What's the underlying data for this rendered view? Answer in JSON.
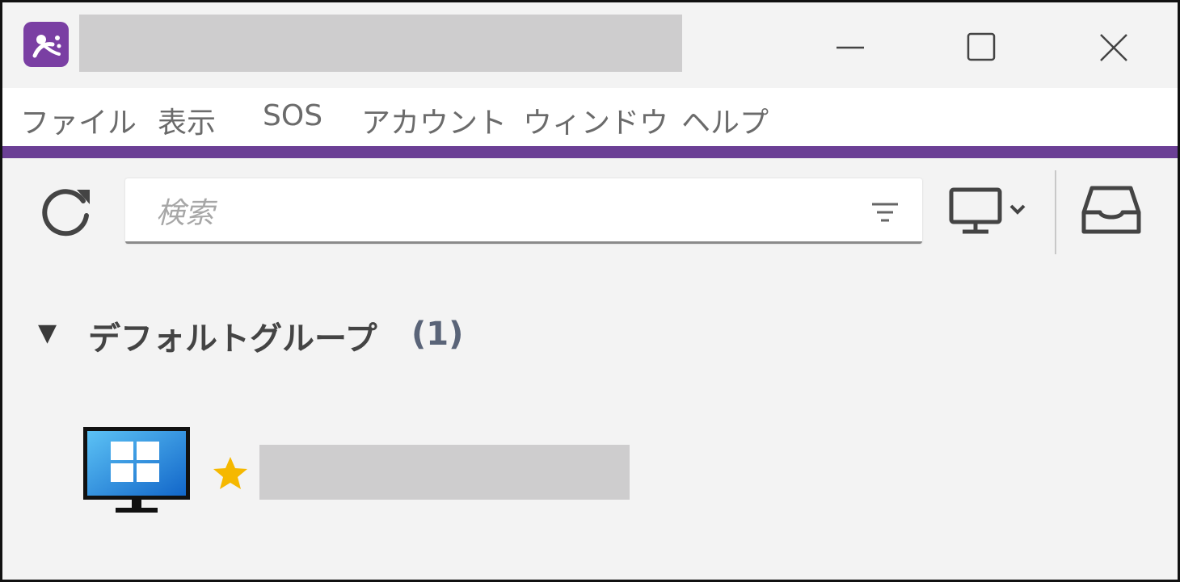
{
  "titlebar": {
    "app_icon": "splashtop-app-icon",
    "title_redacted": true,
    "buttons": [
      "minimize-icon",
      "maximize-icon",
      "close-icon"
    ]
  },
  "menu": {
    "items": [
      "ファイル",
      "表示",
      "SOS",
      "アカウント",
      "ウィンドウ",
      "ヘルプ"
    ]
  },
  "toolbar": {
    "refresh_icon": "refresh-icon",
    "search_placeholder": "検索",
    "filter_icon": "filter-icon",
    "view_icon": "monitor-dropdown-icon",
    "inbox_icon": "inbox-icon"
  },
  "group": {
    "name": "デフォルトグループ",
    "count": "(1)"
  },
  "computers": [
    {
      "os_icon": "windows-computer-icon",
      "favorite": true,
      "name_redacted": true
    }
  ],
  "colors": {
    "accent": "#6b3f95",
    "app_icon_bg": "#7a3fa3",
    "star": "#f5b800",
    "redaction": "#cecdce"
  }
}
